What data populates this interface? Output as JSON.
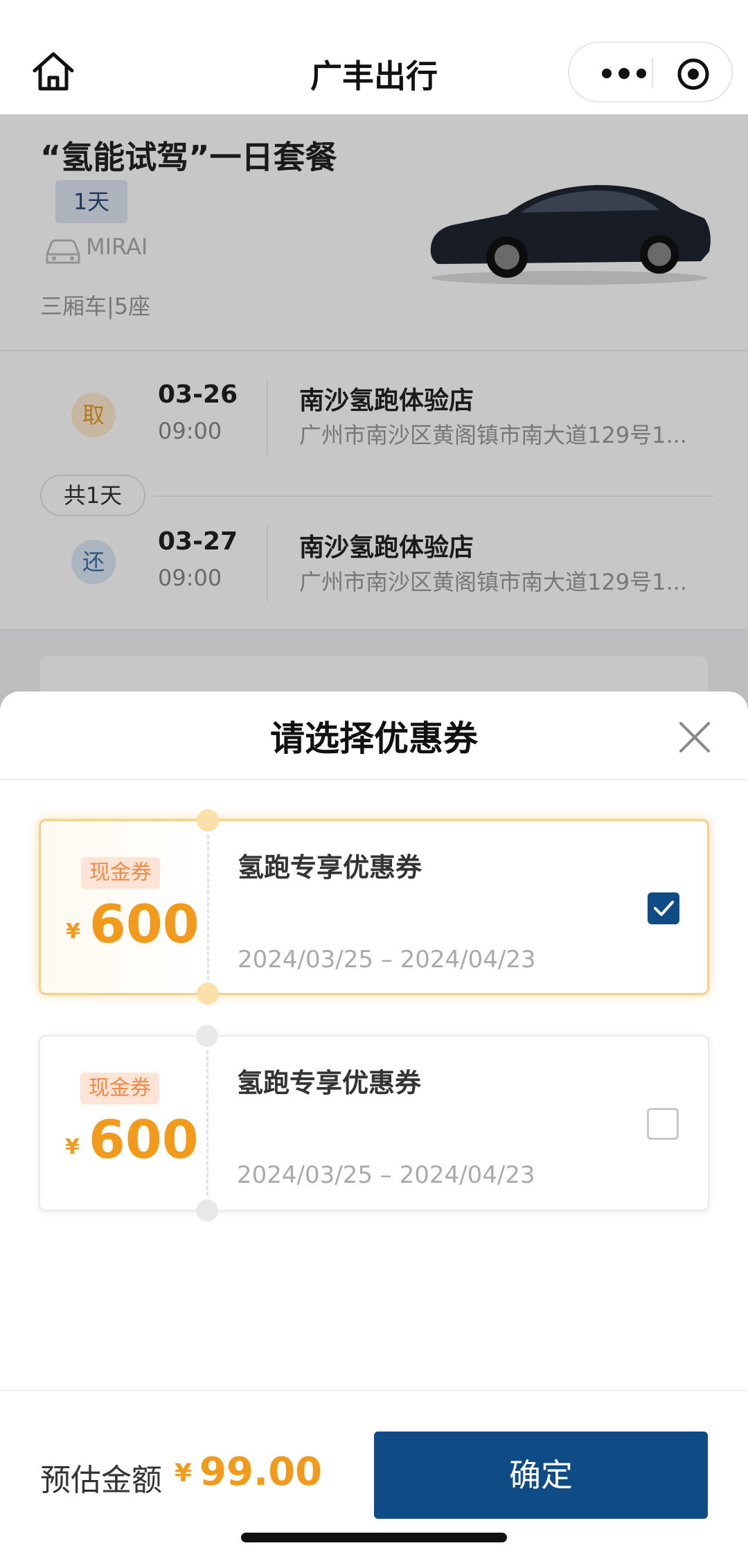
{
  "header": {
    "title": "广丰出行",
    "icons": {
      "home": "home-icon",
      "more": "more-dots-icon",
      "target": "target-icon"
    }
  },
  "package": {
    "title": "“氢能试驾”一日套餐",
    "day_badge": "1天",
    "model": "MIRAI",
    "car_type": "三厢车|5座"
  },
  "trip": {
    "pickup": {
      "badge": "取",
      "date": "03-26",
      "time": "09:00",
      "store": "南沙氢跑体验店",
      "address": "广州市南沙区黄阁镇市南大道129号1..."
    },
    "duration": "共1天",
    "return": {
      "badge": "还",
      "date": "03-27",
      "time": "09:00",
      "store": "南沙氢跑体验店",
      "address": "广州市南沙区黄阁镇市南大道129号1..."
    }
  },
  "sheet": {
    "title": "请选择优惠券",
    "coupons": [
      {
        "tag": "现金券",
        "currency": "¥",
        "amount": "600",
        "name": "氢跑专享优惠券",
        "validity": "2024/03/25 – 2024/04/23",
        "selected": true
      },
      {
        "tag": "现金券",
        "currency": "¥",
        "amount": "600",
        "name": "氢跑专享优惠券",
        "validity": "2024/03/25 – 2024/04/23",
        "selected": false
      }
    ]
  },
  "footer": {
    "estimate_label": "预估金额",
    "currency": "¥",
    "estimate_amount": "99.00",
    "confirm_label": "确定"
  },
  "colors": {
    "brand_blue": "#0f4b85",
    "price_orange": "#f29a1c",
    "selected_border": "#f7cf88"
  }
}
